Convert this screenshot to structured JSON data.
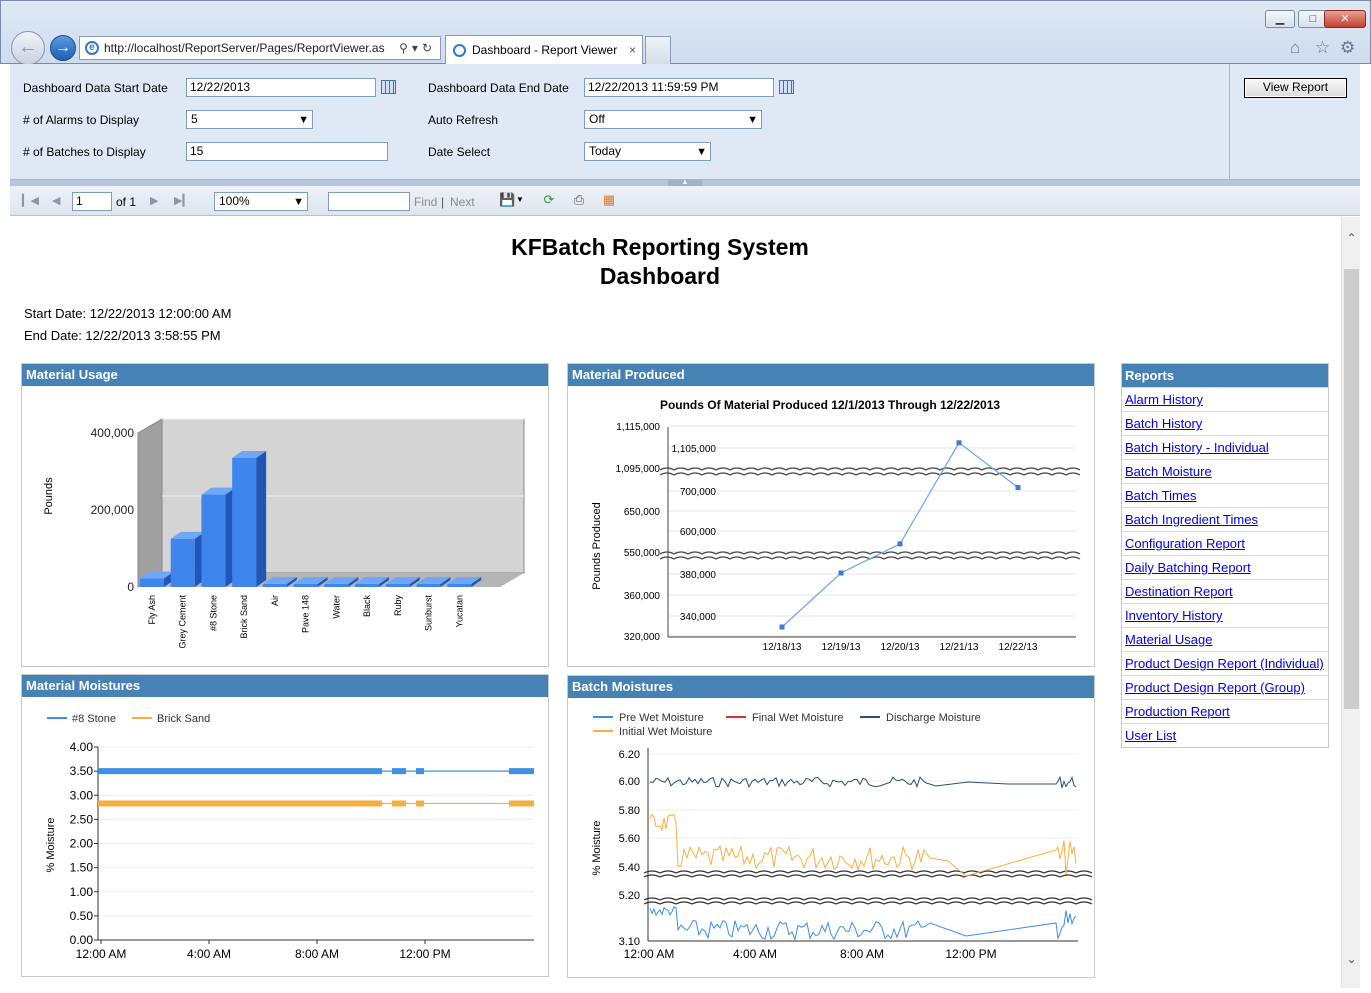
{
  "browser": {
    "url": "http://localhost/ReportServer/Pages/ReportViewer.as",
    "tab_title": "Dashboard - Report Viewer",
    "tab_close": "×",
    "window_buttons": [
      "▁",
      "□",
      "✕"
    ]
  },
  "params": {
    "start_date_label": "Dashboard Data Start Date",
    "start_date_value": "12/22/2013",
    "end_date_label": "Dashboard Data End Date",
    "end_date_value": "12/22/2013 11:59:59 PM",
    "alarms_label": "# of Alarms to Display",
    "alarms_value": "5",
    "auto_refresh_label": "Auto Refresh",
    "auto_refresh_value": "Off",
    "batches_label": "# of Batches to Display",
    "batches_value": "15",
    "date_select_label": "Date Select",
    "date_select_value": "Today",
    "view_report_label": "View Report"
  },
  "toolbar": {
    "page_value": "1",
    "of_pages": "of 1",
    "zoom_value": "100%",
    "find_value": "",
    "find_label": "Find",
    "divider": "|",
    "next_label": "Next"
  },
  "report": {
    "title_line1": "KFBatch Reporting System",
    "title_line2": "Dashboard",
    "start_date": "Start Date:  12/22/2013 12:00:00 AM",
    "end_date": "End Date:  12/22/2013 3:58:55 PM"
  },
  "panels": {
    "material_usage": "Material Usage",
    "material_produced": "Material Produced",
    "material_moistures": "Material Moistures",
    "batch_moistures": "Batch Moistures"
  },
  "reports_panel": {
    "header": "Reports",
    "links": [
      "Alarm History",
      "Batch History",
      "Batch History - Individual",
      "Batch Moisture",
      "Batch Times",
      "Batch Ingredient Times",
      "Configuration Report",
      "Daily Batching Report",
      "Destination Report",
      "Inventory History",
      "Material Usage",
      "Product Design Report (Individual)",
      "Product Design Report (Group)",
      "Production Report",
      "User List"
    ]
  },
  "colors": {
    "panel_header": "#4682b4",
    "bar_fill": "#3e85ee",
    "stone_series": "#3e8fe6",
    "sand_series": "#f5b041",
    "final_wet": "#c0392b",
    "discharge": "#2c4f6b"
  },
  "chart_data": [
    {
      "type": "bar",
      "title": "",
      "ylabel": "Pounds",
      "categories": [
        "Fly Ash",
        "Grey Cement",
        "#8 Stone",
        "Brick Sand",
        "Air",
        "Pave 148",
        "Water",
        "Black",
        "Ruby",
        "Sunburst",
        "Yucatan"
      ],
      "values": [
        22000,
        125000,
        240000,
        335000,
        0,
        0,
        0,
        0,
        0,
        0,
        0
      ],
      "ylim": [
        0,
        400000
      ],
      "yticks": [
        "0",
        "200,000",
        "400,000"
      ]
    },
    {
      "type": "line",
      "title": "Pounds Of Material Produced 12/1/2013 Through 12/22/2013",
      "ylabel": "Pounds Produced",
      "categories": [
        "12/18/13",
        "12/19/13",
        "12/20/13",
        "12/21/13",
        "12/22/13"
      ],
      "values": [
        330000,
        390000,
        570000,
        1107000,
        760000
      ],
      "yticks": [
        "1,115,000",
        "1,105,000",
        "1,095,000",
        "700,000",
        "650,000",
        "600,000",
        "550,000",
        "380,000",
        "360,000",
        "340,000",
        "320,000"
      ]
    },
    {
      "type": "line",
      "ylabel": "% Moisture",
      "x_ticks": [
        "12:00 AM",
        "4:00 AM",
        "8:00 AM",
        "12:00 PM"
      ],
      "yticks": [
        "4.00",
        "3.50",
        "3.00",
        "2.50",
        "2.00",
        "1.50",
        "1.00",
        "0.50",
        "0.00"
      ],
      "ylim": [
        0,
        4
      ],
      "series": [
        {
          "name": "#8 Stone",
          "value": 3.5
        },
        {
          "name": "Brick Sand",
          "value": 2.83
        }
      ]
    },
    {
      "type": "line",
      "ylabel": "% Moisture",
      "x_ticks": [
        "12:00 AM",
        "4:00 AM",
        "8:00 AM",
        "12:00 PM"
      ],
      "yticks": [
        "6.20",
        "6.00",
        "5.80",
        "5.60",
        "5.40",
        "5.20",
        "3.10"
      ],
      "series": [
        {
          "name": "Pre Wet Moisture"
        },
        {
          "name": "Final Wet Moisture"
        },
        {
          "name": "Discharge Moisture"
        },
        {
          "name": "Initial Wet Moisture"
        }
      ]
    }
  ]
}
